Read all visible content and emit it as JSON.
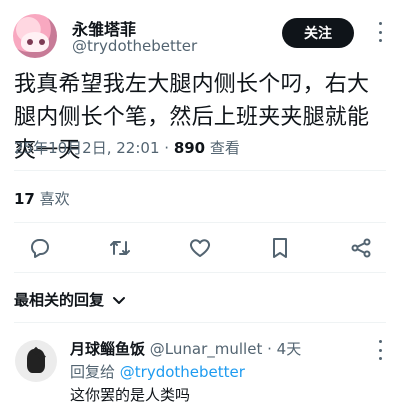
{
  "post": {
    "author_name": "永雏塔菲",
    "author_handle": "@trydothebetter",
    "follow_label": "关注",
    "text": "我真希望我左大腿内侧长个叼，右大腿内侧长个笔，然后上班夹夹腿就能爽一天",
    "timestamp": "25年10月2日, 22:01",
    "views_count": "890",
    "views_label": "查看",
    "likes_count": "17",
    "likes_label": "喜欢"
  },
  "actions": [
    {
      "name": "reply",
      "icon": "reply-icon"
    },
    {
      "name": "retweet",
      "icon": "retweet-icon"
    },
    {
      "name": "like",
      "icon": "heart-icon"
    },
    {
      "name": "bookmark",
      "icon": "bookmark-icon"
    },
    {
      "name": "share",
      "icon": "share-icon"
    }
  ],
  "replies": {
    "sort_label": "最相关的回复",
    "items": [
      {
        "name": "月球鲻鱼饭",
        "handle": "@Lunar_mullet",
        "time": "4天",
        "reply_to_prefix": "回复给",
        "reply_to_handle": "@trydothebetter",
        "text": "这你罢的是人类吗"
      }
    ]
  },
  "colors": {
    "text": "#0f1419",
    "muted": "#536471",
    "link": "#1d9bf0",
    "button": "#0f1419",
    "divider": "#eff3f4"
  }
}
